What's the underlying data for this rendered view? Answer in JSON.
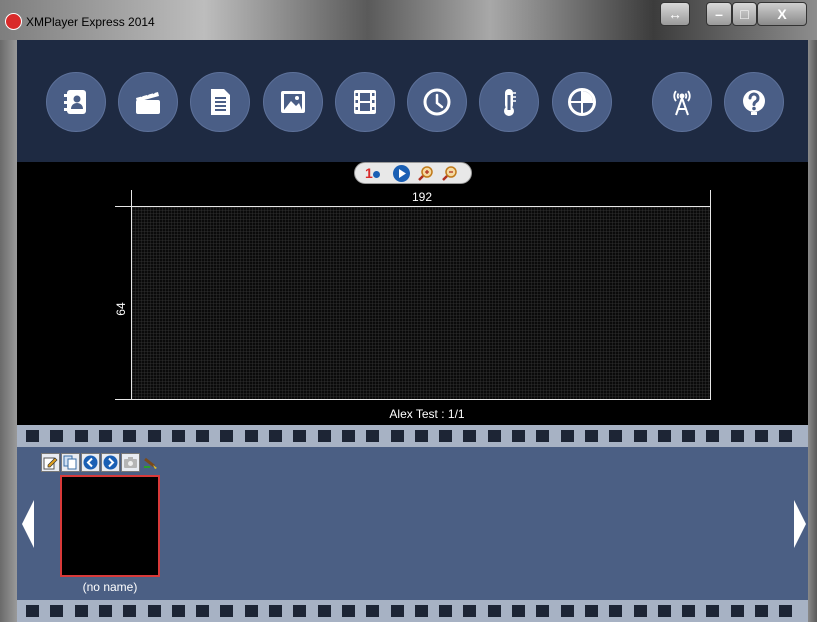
{
  "window": {
    "title": "XMPlayer Express 2014",
    "controls": [
      "restore-layout-icon",
      "minimize-icon",
      "maximize-icon",
      "close-icon"
    ],
    "close_label": "X"
  },
  "toolbar": {
    "buttons": [
      {
        "name": "contacts-book-icon"
      },
      {
        "name": "clapperboard-icon"
      },
      {
        "name": "document-icon"
      },
      {
        "name": "image-icon"
      },
      {
        "name": "film-icon"
      },
      {
        "name": "clock-icon"
      },
      {
        "name": "thermometer-icon"
      },
      {
        "name": "radar-icon"
      },
      {
        "name": "antenna-icon"
      },
      {
        "name": "help-icon"
      }
    ],
    "button_color": "#4a5e86",
    "background": "#1e2a42"
  },
  "preview": {
    "zoom_tools": [
      {
        "name": "actual-size-icon",
        "text": "1"
      },
      {
        "name": "play-icon"
      },
      {
        "name": "zoom-in-icon"
      },
      {
        "name": "zoom-out-icon"
      }
    ],
    "width_label": "192",
    "height_label": "64",
    "caption": "Alex Test : 1/1"
  },
  "filmstrip": {
    "tools": [
      {
        "name": "edit-icon"
      },
      {
        "name": "copy-icon"
      },
      {
        "name": "move-left-icon"
      },
      {
        "name": "move-right-icon"
      },
      {
        "name": "camera-icon"
      },
      {
        "name": "brush-icon"
      }
    ],
    "slides": [
      {
        "label": "(no name)",
        "selected": true
      }
    ],
    "selected_border_color": "#d93a3a",
    "background": "#4b5f84"
  }
}
